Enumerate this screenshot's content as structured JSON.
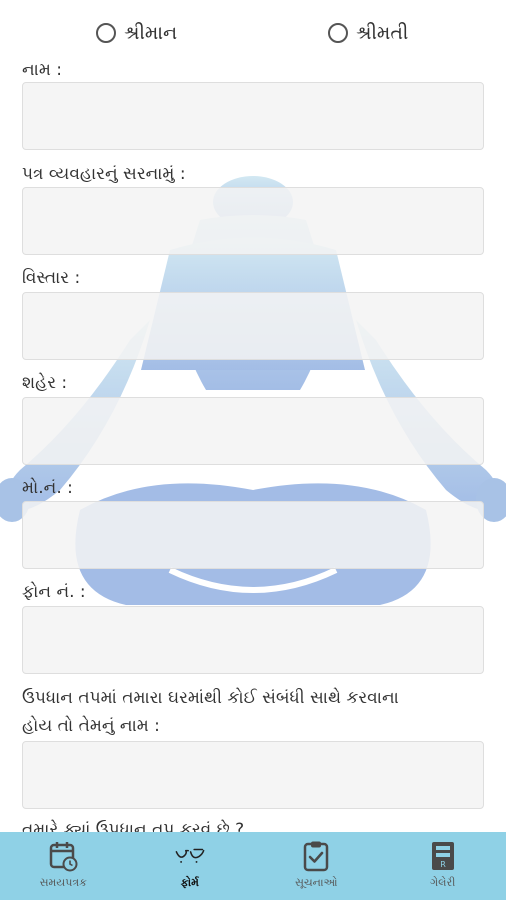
{
  "gender": {
    "option1": "શ્રીમાન",
    "option2": "શ્રીમતી"
  },
  "fields": {
    "name_label": "નામ :",
    "address_label": "પત્ર વ્યવહારનું સરનામું :",
    "area_label": "વિસ્તાર :",
    "city_label": "શહેર :",
    "mobile_label": "મો.નં. :",
    "phone_label": "ફોન નં. :",
    "relative_label_line1": "ઉપધાન તપમાં તમારા ઘરમાંથી કોઈ સંબંધી સાથે કરવાના",
    "relative_label_line2": "હોય તો તેમનું નામ :",
    "next_question_partial": "તમારે ક્યાં ઉપધાન તપ કરવું છે ?"
  },
  "nav": {
    "items": [
      {
        "label": "સમયપત્રક",
        "icon": "calendar-clock-icon"
      },
      {
        "label": "ફોર્મ",
        "icon": "form-logo-icon"
      },
      {
        "label": "સૂચનાઓ",
        "icon": "clipboard-check-icon"
      },
      {
        "label": "ગેલેરી",
        "icon": "gallery-icon"
      }
    ],
    "active_index": 1
  },
  "colors": {
    "nav_background": "#8fd1e6",
    "figure_light": "#c6e2ef",
    "figure_dark": "#a6c3e6",
    "input_background": "#f3f3f3"
  }
}
